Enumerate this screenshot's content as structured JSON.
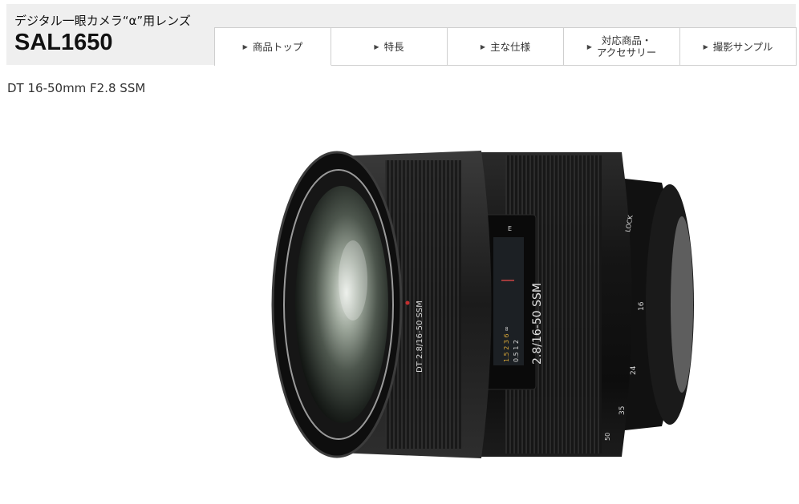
{
  "header": {
    "subtitle": "デジタル一眼カメラ“α”用レンズ",
    "model": "SAL1650"
  },
  "tabs": [
    {
      "label": "商品トップ",
      "active": true
    },
    {
      "label": "特長",
      "active": false
    },
    {
      "label": "主な仕様",
      "active": false
    },
    {
      "label": "対応商品・\nアクセサリー",
      "active": false
    },
    {
      "label": "撮影サンプル",
      "active": false
    }
  ],
  "product_name": "DT 16-50mm F2.8 SSM",
  "lens": {
    "barrel_text": "DT 2.8/16-50 SSM",
    "window_text": "2.8/16-50 SSM",
    "lock_text": "LOCK",
    "zoom_marks": [
      "16",
      "24",
      "35",
      "50"
    ],
    "distance_marks": [
      "1.5",
      "2",
      "3",
      "6",
      "∞"
    ],
    "distance_marks_ft": [
      "0.5",
      "1",
      "2"
    ],
    "window_header": "E"
  }
}
